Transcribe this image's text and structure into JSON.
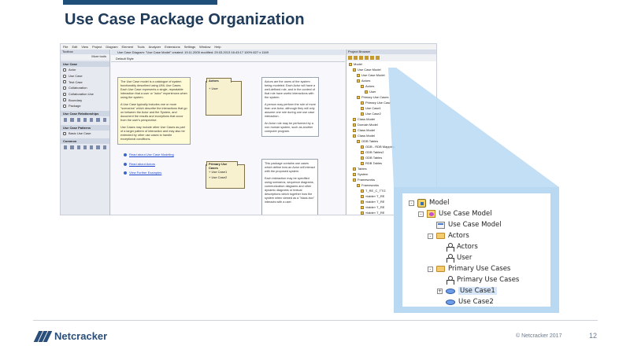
{
  "slide": {
    "title": "Use Case Package Organization",
    "copyright": "© Netcracker 2017",
    "page_number": "12",
    "logo_text": "Netcracker"
  },
  "app": {
    "menu": [
      "File",
      "Edit",
      "View",
      "Project",
      "Diagram",
      "Element",
      "Tools",
      "Analyzer",
      "Extensions",
      "Settings",
      "Window",
      "Help"
    ],
    "toolbox_title": "Toolbox",
    "more_tools": "More tools",
    "sections": [
      {
        "title": "Use Case",
        "items": [
          "Actor",
          "Use Case",
          "Test Case",
          "Collaboration",
          "Collaboration Use",
          "Boundary",
          "Package"
        ]
      },
      {
        "title": "Use Case Relationships",
        "items": []
      },
      {
        "title": "Use Case Patterns",
        "items": [
          "Basic Use Case"
        ]
      },
      {
        "title": "Common",
        "items": []
      }
    ],
    "diagram_tab": "Use Case Diagram: \"Use Case Model\"   created: 19.11.2005  modified: 29.03.2013 16:43:17   100%   827 x 1169",
    "diagram_toolbar": "Default Style",
    "note_main": [
      "The Use Case model is a catalogue of system functionality described using UML Use Cases. Each Use Case represents a single, repeatable interaction that a user or \"actor\" experiences when using the system.",
      "A Use Case typically includes one or more \"scenarios\" which describe the interactions that go on between the Actor and the System, and document the results and exceptions that occur from the user's perspective.",
      "Use Cases may include other Use Cases as part of a larger pattern of interaction and may also be extended by other use cases to handle exceptional conditions."
    ],
    "pkg_actors": {
      "title": "Actors",
      "items": [
        "+ User"
      ]
    },
    "pkg_primary": {
      "title": "Primary Use Cases",
      "items": [
        "+ Use Case1",
        "+ Use Case2"
      ]
    },
    "note_actors": [
      "Actors are the users of the system being modeled. Each Actor will have a well-defined role, and in the context of that role have useful interactions with the system.",
      "A person may perform the role of more than one Actor, although they will only assume one role during one use case interaction.",
      "An Actor role may be performed by a non-human system, such as another computer program."
    ],
    "note_package": [
      "This package contains use cases which define how an Actor will interact with the proposed system.",
      "Each interaction may be specified using scenarios, sequence diagrams, communication diagrams and other dynamic diagrams or textual descriptions which together how the system when viewed as a \"black-box\" interacts with a user."
    ],
    "links": [
      "Read about Use Case Modeling",
      "Read about Actors",
      "View Further Examples"
    ],
    "browser_title": "Project Browser",
    "tree": [
      "Model",
      "Use Case Model",
      "Use Case Model",
      "Actors",
      "Actors",
      "User",
      "Primary Use Cases",
      "Primary Use Case",
      "Use Case1",
      "Use Case2",
      "Class Model",
      "Domain Model",
      "Class Model",
      "Class Model",
      "ODB Tables",
      "ODB - RDB Mapping",
      "ODB Tables2",
      "ODB Tables",
      "RDB Tables",
      "Tables",
      "System",
      "Frameworks",
      "Frameworks",
      "T_RE_C_TTG",
      "«table» T_RE",
      "«table» T_RE",
      "«table» T_RE",
      "«table» T_RE",
      "«table» T_RE"
    ]
  },
  "zoom": {
    "rows": [
      {
        "label": "Model",
        "icon": "model",
        "expander": "-"
      },
      {
        "label": "Use Case Model",
        "icon": "ucmodel",
        "expander": "-"
      },
      {
        "label": "Use Case Model",
        "icon": "diagram",
        "expander": ""
      },
      {
        "label": "Actors",
        "icon": "folder",
        "expander": "-"
      },
      {
        "label": "Actors",
        "icon": "actor",
        "expander": ""
      },
      {
        "label": "User",
        "icon": "actor",
        "expander": ""
      },
      {
        "label": "Primary Use Cases",
        "icon": "folder",
        "expander": "-"
      },
      {
        "label": "Primary Use Cases",
        "icon": "actor",
        "expander": ""
      },
      {
        "label": "Use Case1",
        "icon": "usecase",
        "expander": "+"
      },
      {
        "label": "Use Case2",
        "icon": "usecase",
        "expander": ""
      }
    ],
    "selected": "Use Case1",
    "callout_color": "#b9d9f3"
  }
}
